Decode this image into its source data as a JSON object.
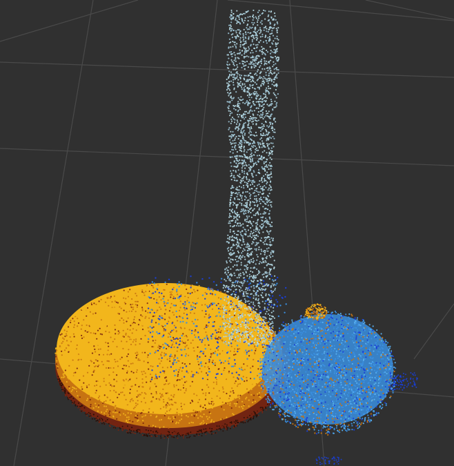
{
  "scene": {
    "background": "#303030",
    "grid_color": "#4a4a4a",
    "objects": [
      {
        "name": "container-pointcloud",
        "color_primary": "#f2b61c",
        "color_secondary": "#c77412",
        "color_edge": "#7a2410"
      },
      {
        "name": "water-column-pointcloud",
        "color_primary": "#b8dbe6",
        "color_secondary": "#9cc4d6"
      },
      {
        "name": "fluid-particles-pointcloud",
        "color_primary": "#3a8fe0",
        "color_secondary": "#1a3fd8",
        "color_tertiary": "#5ab0f0"
      }
    ]
  }
}
